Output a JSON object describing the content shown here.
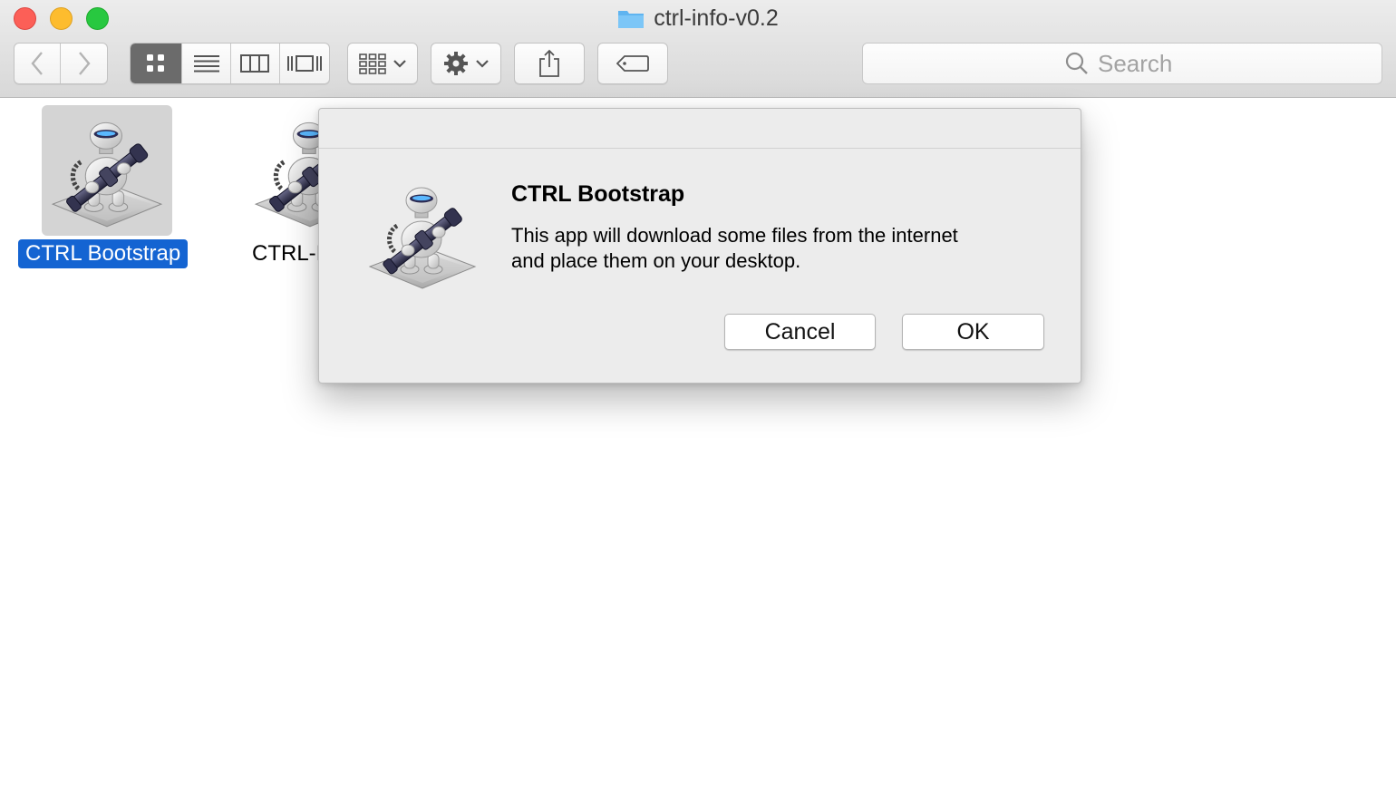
{
  "window": {
    "title": "ctrl-info-v0.2"
  },
  "toolbar": {
    "back_icon": "chevron-left-icon",
    "forward_icon": "chevron-right-icon",
    "view_modes": [
      "icon-view",
      "list-view",
      "column-view",
      "cover-flow-view"
    ],
    "active_view": "icon-view",
    "arrange_icon": "arrange-grid-icon",
    "action_icon": "gear-icon",
    "share_icon": "share-icon",
    "tag_icon": "tag-icon"
  },
  "search": {
    "placeholder": "Search"
  },
  "files": [
    {
      "label": "CTRL Bootstrap",
      "selected": true
    },
    {
      "label": "CTRL-I",
      "selected": false
    }
  ],
  "dialog": {
    "title": "CTRL Bootstrap",
    "message_line1": "This app will download some files from the internet",
    "message_line2": "and place them on your desktop.",
    "cancel_label": "Cancel",
    "ok_label": "OK"
  },
  "colors": {
    "selection": "#1464d2",
    "close": "#fc5f57",
    "minimize": "#fdbc2e",
    "maximize": "#28c840"
  }
}
